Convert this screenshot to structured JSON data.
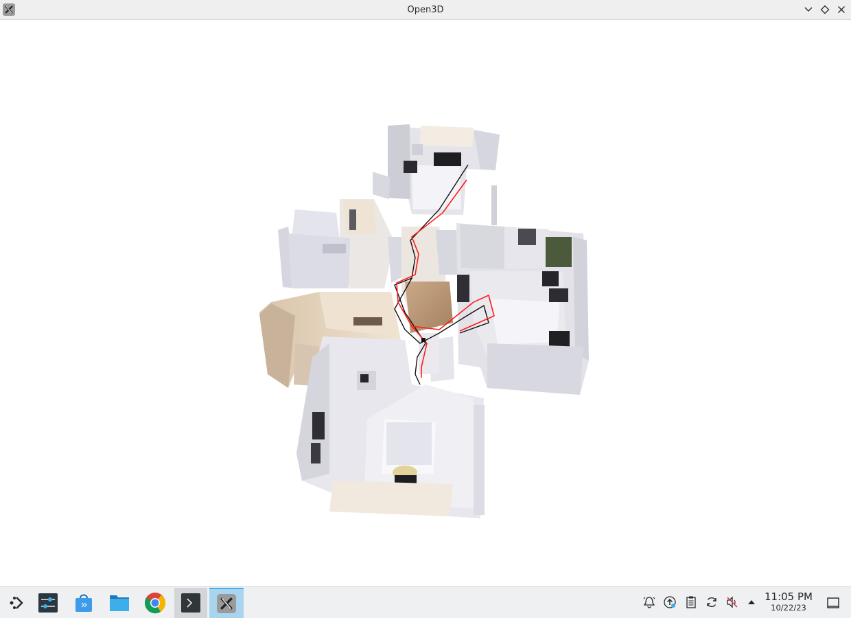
{
  "window": {
    "title": "Open3D",
    "icon": "open3d-icon",
    "controls": [
      "minimize-icon",
      "maximize-icon",
      "close-icon"
    ]
  },
  "viewport": {
    "content": "3d-point-cloud-scene",
    "background": "#ffffff",
    "path_colors": {
      "estimated": "#ff1a1a",
      "ground_truth": "#111111"
    }
  },
  "taskbar": {
    "launchers": [
      {
        "name": "application-launcher",
        "icon": "plasma-launcher-icon"
      },
      {
        "name": "system-settings",
        "icon": "settings-sliders-icon"
      },
      {
        "name": "discover-store",
        "icon": "store-bag-icon"
      },
      {
        "name": "file-manager",
        "icon": "folder-icon"
      },
      {
        "name": "chrome-browser",
        "icon": "chrome-icon"
      },
      {
        "name": "terminal",
        "icon": "terminal-icon"
      },
      {
        "name": "open3d-window",
        "icon": "open3d-icon"
      }
    ],
    "tray": [
      "notifications-icon",
      "update-icon",
      "clipboard-icon",
      "sync-icon",
      "volume-muted-icon",
      "expand-tray-icon"
    ],
    "clock": {
      "time": "11:05 PM",
      "date": "10/22/23"
    },
    "show_desktop": "show-desktop-icon"
  }
}
